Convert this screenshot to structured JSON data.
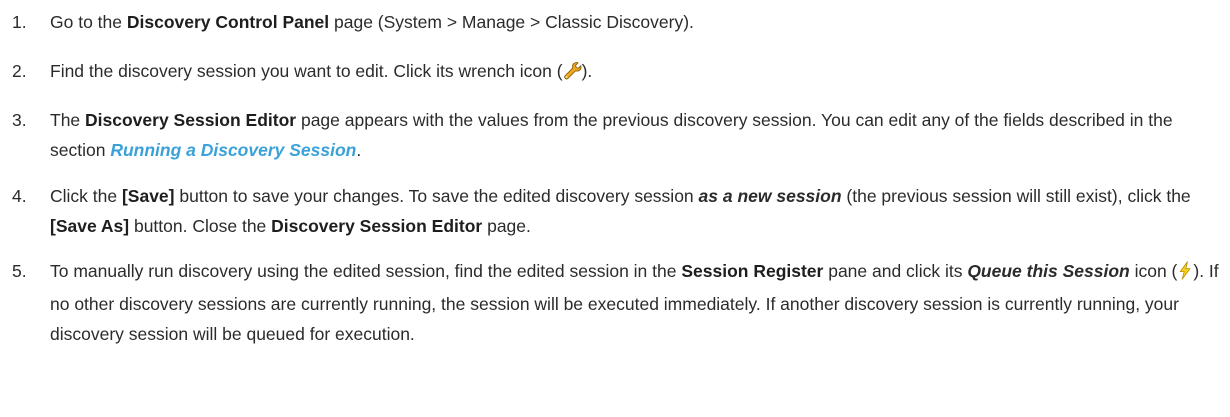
{
  "steps": [
    {
      "num": "1.",
      "t1": "Go to the ",
      "b1": "Discovery Control Panel",
      "t2": " page (System > Manage > Classic Discovery)."
    },
    {
      "num": "2.",
      "t1": "Find the discovery session you want to edit. Click its wrench icon (",
      "icon": "wrench-icon",
      "t2": ")."
    },
    {
      "num": "3.",
      "t1": "The ",
      "b1": "Discovery Session Editor",
      "t2": " page appears with the values from the previous discovery session. You can edit any of the fields described in the section ",
      "link": "Running a Discovery Session",
      "t3": "."
    },
    {
      "num": "4.",
      "t1": "Click the ",
      "b1": "[Save]",
      "t2": " button to save your changes. To save the edited discovery session ",
      "e1": "as a new session",
      "t3": " (the previous session will still exist), click the ",
      "b2": "[Save As]",
      "t4": " button. Close the ",
      "b3": "Discovery Session Editor",
      "t5": " page."
    },
    {
      "num": "5.",
      "t1": "To manually run discovery using the edited session, find the edited session in the ",
      "b1": "Session Register",
      "t2": " pane and click its ",
      "e1": "Queue this Session",
      "t3": " icon (",
      "icon": "lightning-icon",
      "t4": "). If no other discovery sessions are currently running, the session will be executed immediately. If another discovery session is currently running, your discovery session will be queued for execution."
    }
  ],
  "colors": {
    "link": "#3aa2d8",
    "text": "#2b2b2b"
  }
}
